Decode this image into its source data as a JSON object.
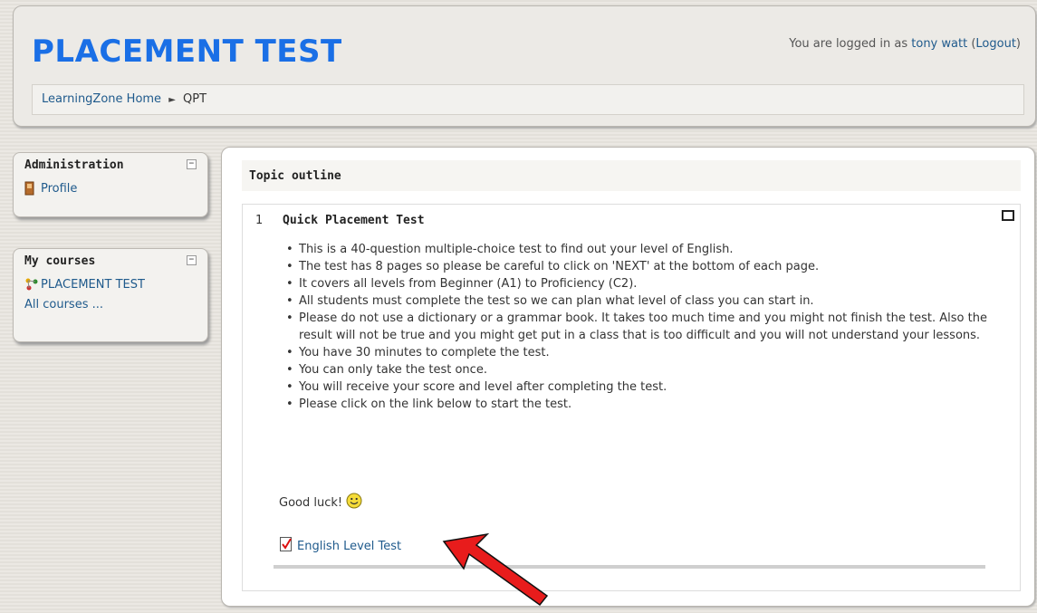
{
  "header": {
    "site_title": "PLACEMENT TEST",
    "login_prefix": "You are logged in as",
    "user_name": "tony watt",
    "logout_label": "Logout"
  },
  "breadcrumb": {
    "home": "LearningZone Home",
    "separator": "►",
    "current": "QPT"
  },
  "admin_block": {
    "title": "Administration",
    "items": [
      {
        "label": "Profile",
        "icon": "profile-icon"
      }
    ]
  },
  "courses_block": {
    "title": "My courses",
    "items": [
      {
        "label": "PLACEMENT TEST",
        "icon": "course-icon"
      }
    ],
    "all_courses": "All courses ..."
  },
  "main": {
    "outline_title": "Topic outline",
    "section_number": "1",
    "section_title": "Quick Placement Test",
    "bullets": [
      "This is a 40-question multiple-choice test to find out your level of English.",
      "The test has 8 pages so please be careful to click on 'NEXT' at the bottom of each page.",
      "It covers all levels from Beginner (A1) to Proficiency (C2).",
      "All students must complete the test so we can plan what level of class you can start in.",
      "Please do not use a dictionary or a grammar book. It takes too much time and you might not finish the test. Also the result will not be true and you might get put in a class that is too difficult and you will not understand your lessons.",
      "You have 30 minutes to complete the test.",
      "You can only take the test once.",
      "You will receive your score and level after completing the test.",
      "Please click on the link below to start the test."
    ],
    "good_luck": "Good luck!",
    "test_link": "English Level Test"
  },
  "colors": {
    "title_blue": "#1a6fe6",
    "link_blue": "#1f5a8c",
    "arrow_red": "#e81c1c"
  }
}
